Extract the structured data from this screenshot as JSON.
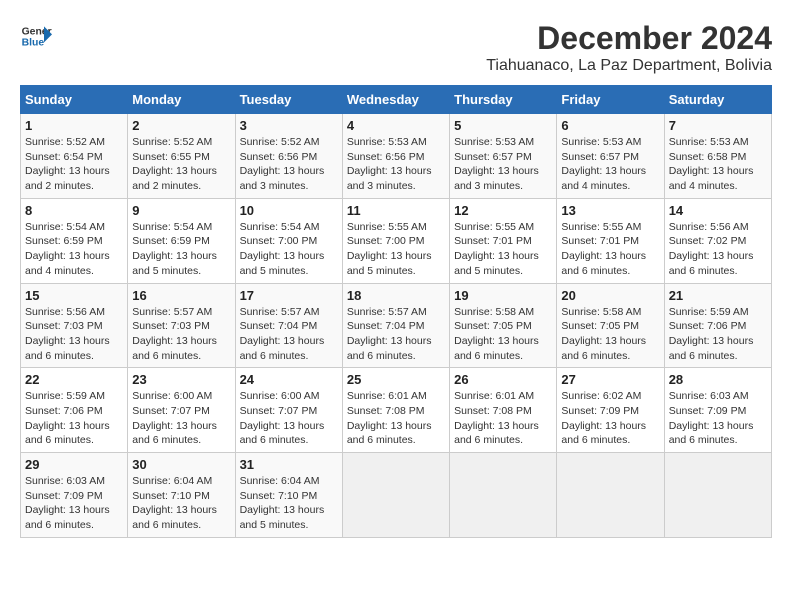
{
  "logo": {
    "line1": "General",
    "line2": "Blue"
  },
  "header": {
    "month": "December 2024",
    "location": "Tiahuanaco, La Paz Department, Bolivia"
  },
  "weekdays": [
    "Sunday",
    "Monday",
    "Tuesday",
    "Wednesday",
    "Thursday",
    "Friday",
    "Saturday"
  ],
  "weeks": [
    [
      {
        "day": "1",
        "sunrise": "5:52 AM",
        "sunset": "6:54 PM",
        "daylight": "13 hours and 2 minutes."
      },
      {
        "day": "2",
        "sunrise": "5:52 AM",
        "sunset": "6:55 PM",
        "daylight": "13 hours and 2 minutes."
      },
      {
        "day": "3",
        "sunrise": "5:52 AM",
        "sunset": "6:56 PM",
        "daylight": "13 hours and 3 minutes."
      },
      {
        "day": "4",
        "sunrise": "5:53 AM",
        "sunset": "6:56 PM",
        "daylight": "13 hours and 3 minutes."
      },
      {
        "day": "5",
        "sunrise": "5:53 AM",
        "sunset": "6:57 PM",
        "daylight": "13 hours and 3 minutes."
      },
      {
        "day": "6",
        "sunrise": "5:53 AM",
        "sunset": "6:57 PM",
        "daylight": "13 hours and 4 minutes."
      },
      {
        "day": "7",
        "sunrise": "5:53 AM",
        "sunset": "6:58 PM",
        "daylight": "13 hours and 4 minutes."
      }
    ],
    [
      {
        "day": "8",
        "sunrise": "5:54 AM",
        "sunset": "6:59 PM",
        "daylight": "13 hours and 4 minutes."
      },
      {
        "day": "9",
        "sunrise": "5:54 AM",
        "sunset": "6:59 PM",
        "daylight": "13 hours and 5 minutes."
      },
      {
        "day": "10",
        "sunrise": "5:54 AM",
        "sunset": "7:00 PM",
        "daylight": "13 hours and 5 minutes."
      },
      {
        "day": "11",
        "sunrise": "5:55 AM",
        "sunset": "7:00 PM",
        "daylight": "13 hours and 5 minutes."
      },
      {
        "day": "12",
        "sunrise": "5:55 AM",
        "sunset": "7:01 PM",
        "daylight": "13 hours and 5 minutes."
      },
      {
        "day": "13",
        "sunrise": "5:55 AM",
        "sunset": "7:01 PM",
        "daylight": "13 hours and 6 minutes."
      },
      {
        "day": "14",
        "sunrise": "5:56 AM",
        "sunset": "7:02 PM",
        "daylight": "13 hours and 6 minutes."
      }
    ],
    [
      {
        "day": "15",
        "sunrise": "5:56 AM",
        "sunset": "7:03 PM",
        "daylight": "13 hours and 6 minutes."
      },
      {
        "day": "16",
        "sunrise": "5:57 AM",
        "sunset": "7:03 PM",
        "daylight": "13 hours and 6 minutes."
      },
      {
        "day": "17",
        "sunrise": "5:57 AM",
        "sunset": "7:04 PM",
        "daylight": "13 hours and 6 minutes."
      },
      {
        "day": "18",
        "sunrise": "5:57 AM",
        "sunset": "7:04 PM",
        "daylight": "13 hours and 6 minutes."
      },
      {
        "day": "19",
        "sunrise": "5:58 AM",
        "sunset": "7:05 PM",
        "daylight": "13 hours and 6 minutes."
      },
      {
        "day": "20",
        "sunrise": "5:58 AM",
        "sunset": "7:05 PM",
        "daylight": "13 hours and 6 minutes."
      },
      {
        "day": "21",
        "sunrise": "5:59 AM",
        "sunset": "7:06 PM",
        "daylight": "13 hours and 6 minutes."
      }
    ],
    [
      {
        "day": "22",
        "sunrise": "5:59 AM",
        "sunset": "7:06 PM",
        "daylight": "13 hours and 6 minutes."
      },
      {
        "day": "23",
        "sunrise": "6:00 AM",
        "sunset": "7:07 PM",
        "daylight": "13 hours and 6 minutes."
      },
      {
        "day": "24",
        "sunrise": "6:00 AM",
        "sunset": "7:07 PM",
        "daylight": "13 hours and 6 minutes."
      },
      {
        "day": "25",
        "sunrise": "6:01 AM",
        "sunset": "7:08 PM",
        "daylight": "13 hours and 6 minutes."
      },
      {
        "day": "26",
        "sunrise": "6:01 AM",
        "sunset": "7:08 PM",
        "daylight": "13 hours and 6 minutes."
      },
      {
        "day": "27",
        "sunrise": "6:02 AM",
        "sunset": "7:09 PM",
        "daylight": "13 hours and 6 minutes."
      },
      {
        "day": "28",
        "sunrise": "6:03 AM",
        "sunset": "7:09 PM",
        "daylight": "13 hours and 6 minutes."
      }
    ],
    [
      {
        "day": "29",
        "sunrise": "6:03 AM",
        "sunset": "7:09 PM",
        "daylight": "13 hours and 6 minutes."
      },
      {
        "day": "30",
        "sunrise": "6:04 AM",
        "sunset": "7:10 PM",
        "daylight": "13 hours and 6 minutes."
      },
      {
        "day": "31",
        "sunrise": "6:04 AM",
        "sunset": "7:10 PM",
        "daylight": "13 hours and 5 minutes."
      },
      null,
      null,
      null,
      null
    ]
  ]
}
